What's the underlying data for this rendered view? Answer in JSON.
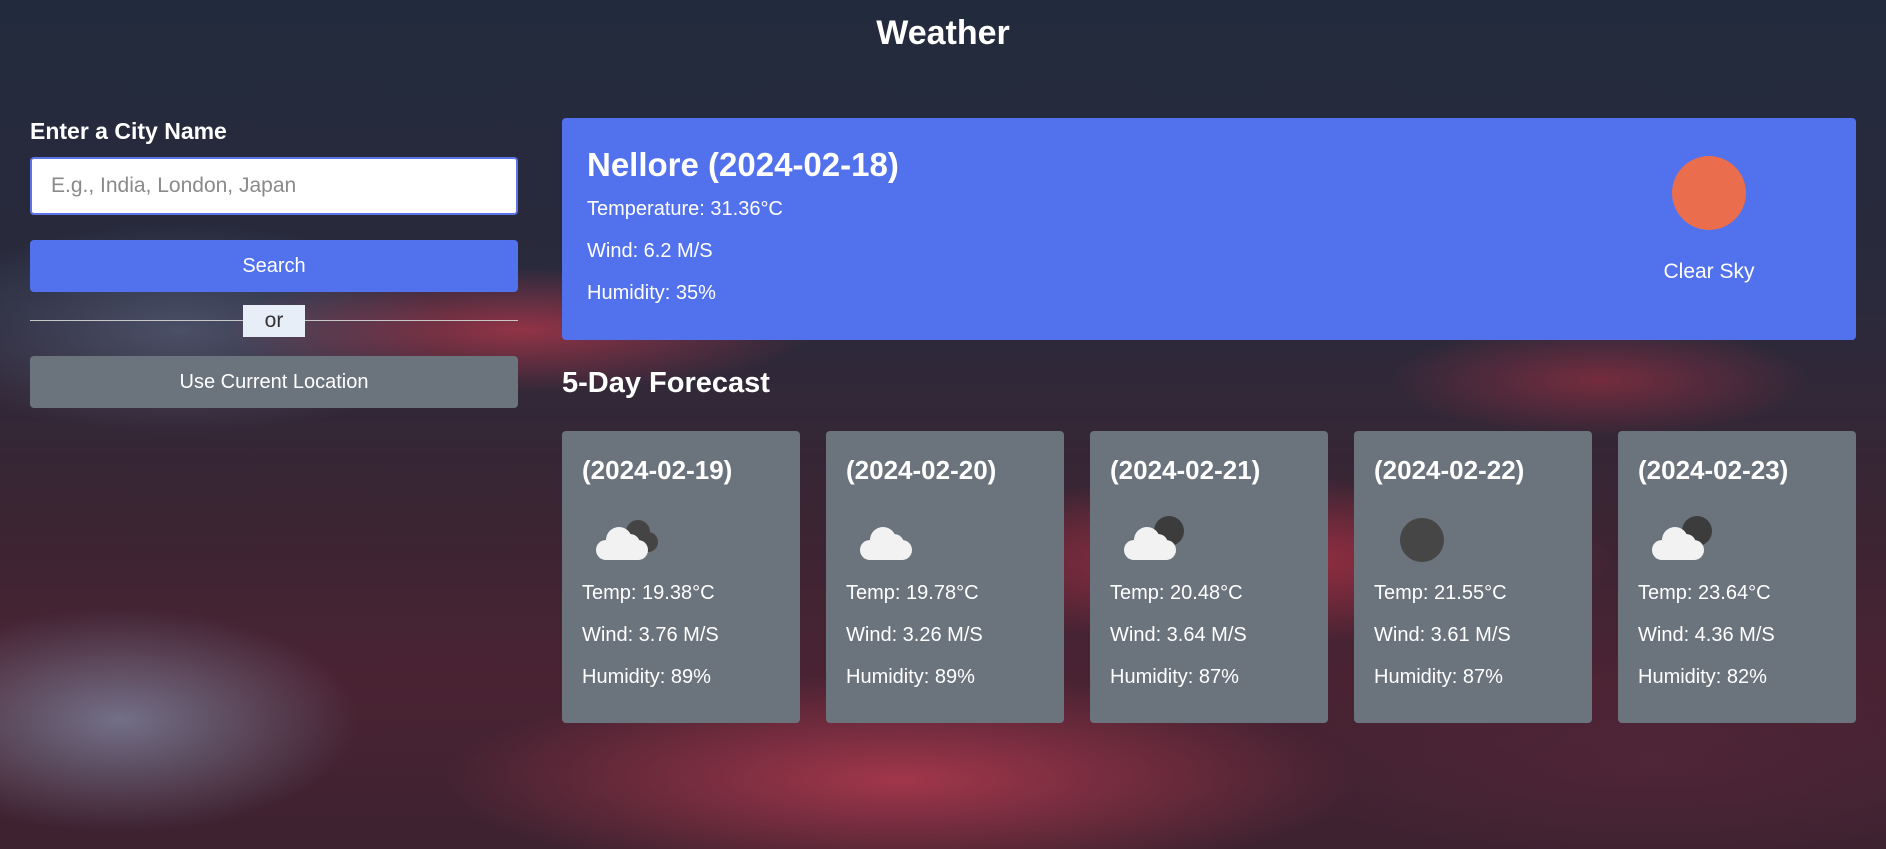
{
  "app": {
    "title": "Weather"
  },
  "search": {
    "label": "Enter a City Name",
    "placeholder": "E.g., India, London, Japan",
    "value": "",
    "search_button": "Search",
    "separator": "or",
    "location_button": "Use Current Location"
  },
  "current": {
    "title": "Nellore (2024-02-18)",
    "temperature": "Temperature: 31.36°C",
    "wind": "Wind: 6.2 M/S",
    "humidity": "Humidity: 35%",
    "description": "Clear Sky",
    "icon": "sun-icon"
  },
  "forecast": {
    "heading": "5-Day Forecast",
    "days": [
      {
        "date": "(2024-02-19)",
        "icon": "broken-clouds-icon",
        "temp": "Temp: 19.38°C",
        "wind": "Wind: 3.76 M/S",
        "humidity": "Humidity: 89%"
      },
      {
        "date": "(2024-02-20)",
        "icon": "cloud-icon",
        "temp": "Temp: 19.78°C",
        "wind": "Wind: 3.26 M/S",
        "humidity": "Humidity: 89%"
      },
      {
        "date": "(2024-02-21)",
        "icon": "partly-cloudy-night-icon",
        "temp": "Temp: 20.48°C",
        "wind": "Wind: 3.64 M/S",
        "humidity": "Humidity: 87%"
      },
      {
        "date": "(2024-02-22)",
        "icon": "clear-night-icon",
        "temp": "Temp: 21.55°C",
        "wind": "Wind: 3.61 M/S",
        "humidity": "Humidity: 87%"
      },
      {
        "date": "(2024-02-23)",
        "icon": "partly-cloudy-night-icon",
        "temp": "Temp: 23.64°C",
        "wind": "Wind: 4.36 M/S",
        "humidity": "Humidity: 82%"
      }
    ]
  },
  "colors": {
    "primary": "#5271ed",
    "secondary": "#6b737c",
    "sun": "#ea6e4d"
  }
}
